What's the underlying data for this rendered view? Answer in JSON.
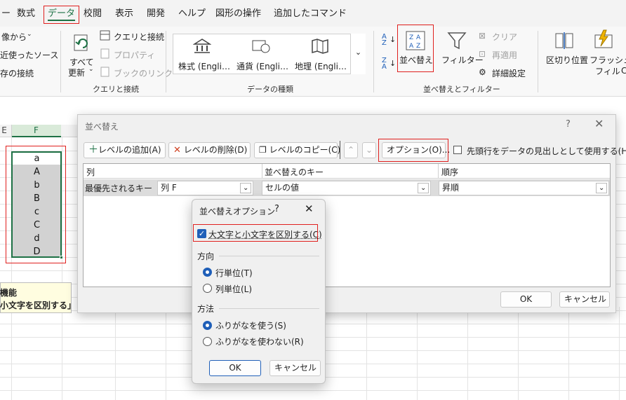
{
  "ribbon": {
    "tabs": [
      "ー",
      "数式",
      "データ",
      "校閲",
      "表示",
      "開発",
      "ヘルプ",
      "図形の操作",
      "追加したコマンド"
    ],
    "left_items": [
      "像から",
      "近使ったソース",
      "存の接続"
    ],
    "refresh_all": "すべて",
    "refresh_all2": "更新",
    "queries": {
      "connections": "クエリと接続",
      "properties": "プロパティ",
      "edit_links": "ブックのリンク",
      "group": "クエリと接続"
    },
    "datatypes": {
      "stocks": "株式 (Engli…",
      "currency": "通貨 (Engli…",
      "geography": "地理 (Engli…",
      "group": "データの種類"
    },
    "sort": {
      "label": "並べ替え",
      "filter": "フィルター",
      "clear": "クリア",
      "reapply": "再適用",
      "advanced": "詳細設定",
      "group": "並べ替えとフィルター"
    },
    "tools": {
      "text_to_columns": "区切り位置",
      "flash_fill1": "フラッシュ",
      "flash_fill2": "フィル",
      "az": "A Z",
      "za": "Z A",
      "sort_icon": "Z A A Z"
    }
  },
  "sheet": {
    "col_e": "E",
    "col_f": "F",
    "cells": [
      "a",
      "A",
      "b",
      "B",
      "c",
      "C",
      "d",
      "D"
    ],
    "tooltip_l1": "機能",
    "tooltip_l2": "小文字を区別する」"
  },
  "sort_dialog": {
    "title": "並べ替え",
    "help": "?",
    "add_level": "レベルの追加(A)",
    "delete_level": "レベルの削除(D)",
    "copy_level": "レベルのコピー(C)",
    "options": "オプション(O)...",
    "header_checkbox": "先頭行をデータの見出しとして使用する(H)",
    "col_header": "列",
    "key_header": "並べ替えのキー",
    "order_header": "順序",
    "row_label": "最優先されるキー",
    "column_value": "列 F",
    "key_value": "セルの値",
    "order_value": "昇順",
    "ok": "OK",
    "cancel": "キャンセル"
  },
  "options_dialog": {
    "title": "並べ替えオプション",
    "help": "?",
    "case_sensitive": "大文字と小文字を区別する(C)",
    "direction_label": "方向",
    "by_rows": "行単位(T)",
    "by_columns": "列単位(L)",
    "method_label": "方法",
    "use_furigana": "ふりがなを使う(S)",
    "no_furigana": "ふりがなを使わない(R)",
    "ok": "OK",
    "cancel": "キャンセル"
  },
  "colors": {
    "accent": "#1f5fb8",
    "highlight": "#e0201e",
    "excel_green": "#1e7145"
  }
}
